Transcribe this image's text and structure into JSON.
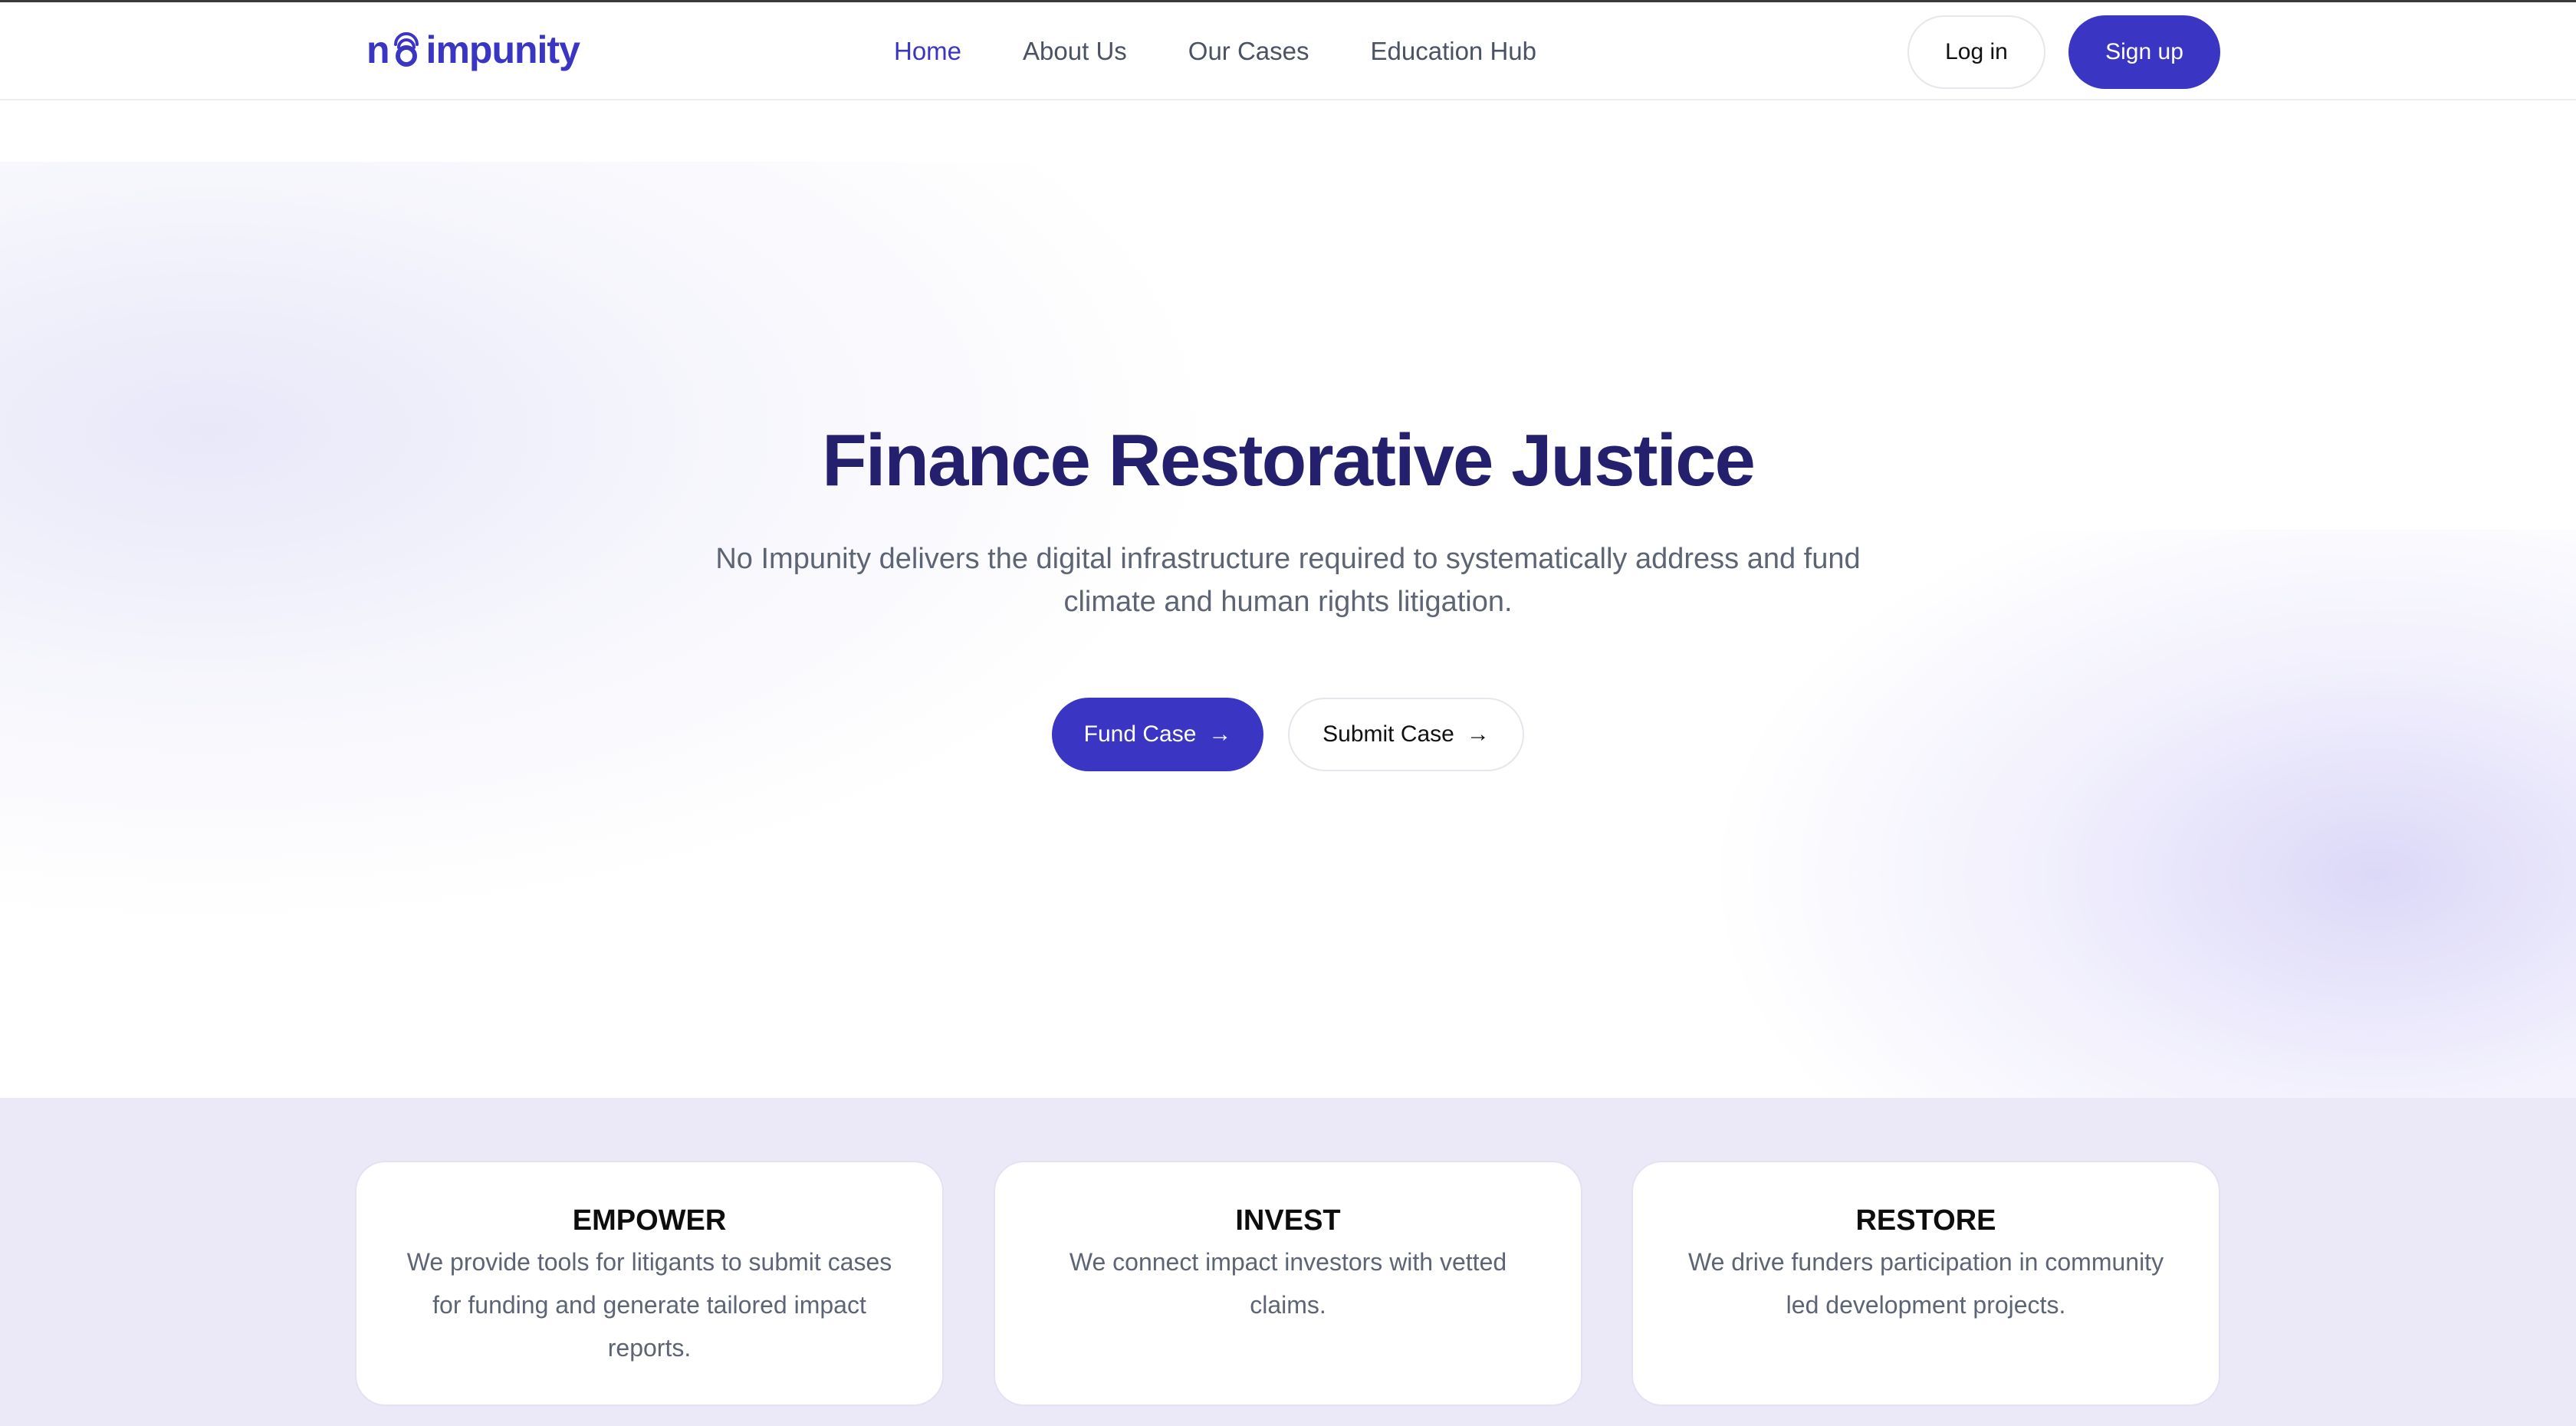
{
  "brand": {
    "logo_prefix": "n",
    "logo_suffix": "impunity",
    "accent_color": "#3b35c3",
    "title_color": "#25206e"
  },
  "nav": {
    "links": [
      {
        "label": "Home",
        "active": true
      },
      {
        "label": "About Us",
        "active": false
      },
      {
        "label": "Our Cases",
        "active": false
      },
      {
        "label": "Education Hub",
        "active": false
      }
    ],
    "login_label": "Log in",
    "signup_label": "Sign up"
  },
  "hero": {
    "title": "Finance Restorative Justice",
    "subtitle": "No Impunity delivers the digital infrastructure required to systematically address and fund climate and human rights litigation.",
    "fund_label": "Fund Case",
    "submit_label": "Submit Case",
    "arrow_icon": "arrow-right-icon"
  },
  "features": [
    {
      "title": "EMPOWER",
      "text": "We provide tools for litigants to submit cases for funding and generate tailored impact reports."
    },
    {
      "title": "INVEST",
      "text": "We connect impact investors with vetted claims."
    },
    {
      "title": "RESTORE",
      "text": "We drive funders participation in community led development projects."
    }
  ]
}
